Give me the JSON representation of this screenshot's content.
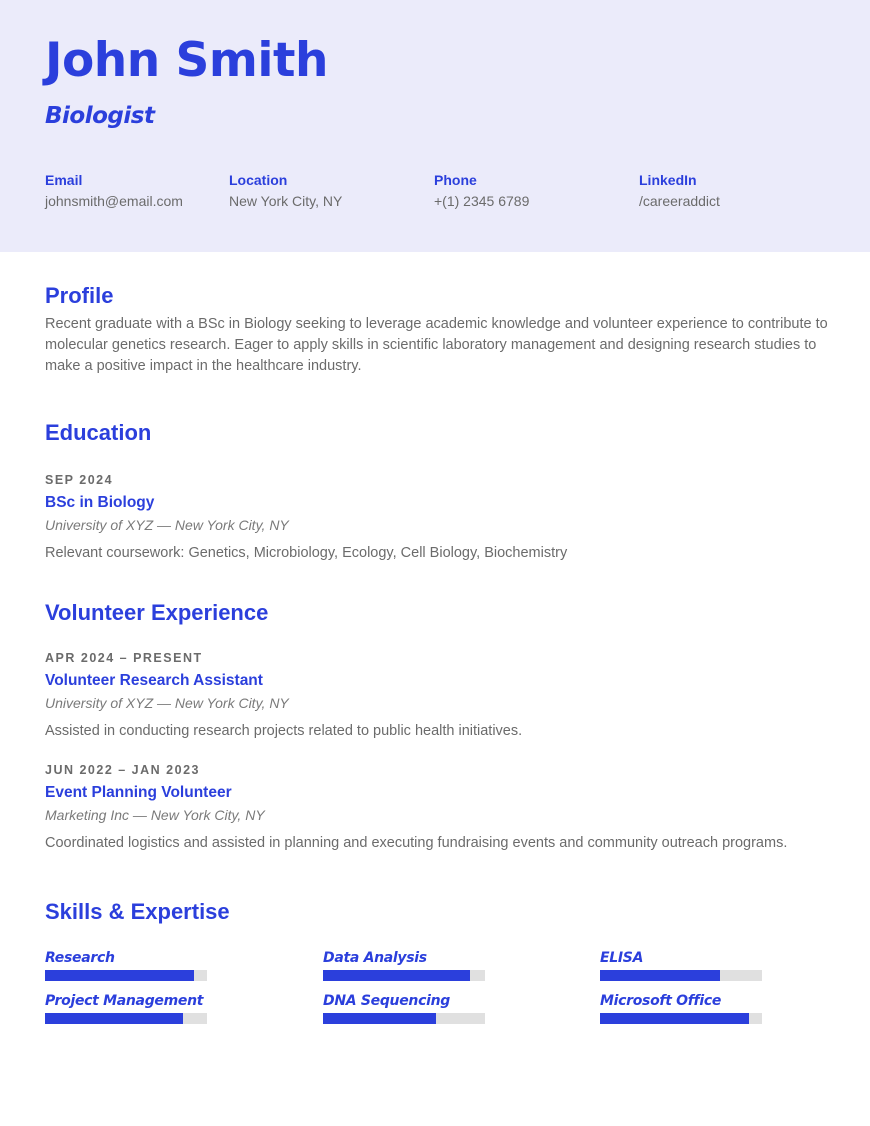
{
  "colors": {
    "accent": "#2b3fdc",
    "header_bg": "#ebebfa",
    "bar_track": "#e0e0e0",
    "text": "#6b6b6b"
  },
  "header": {
    "name": "John Smith",
    "title": "Biologist",
    "contacts": [
      {
        "label": "Email",
        "value": "johnsmith@email.com"
      },
      {
        "label": "Location",
        "value": "New York City, NY"
      },
      {
        "label": "Phone",
        "value": "+(1) 2345 6789"
      },
      {
        "label": "LinkedIn",
        "value": "/careeraddict"
      }
    ]
  },
  "profile": {
    "heading": "Profile",
    "text": "Recent graduate with a BSc in Biology seeking to leverage academic knowledge and volunteer experience to contribute to molecular genetics research. Eager to apply skills in scientific laboratory management and designing research studies to make a positive impact in the healthcare industry."
  },
  "education": {
    "heading": "Education",
    "entries": [
      {
        "date": "SEP 2024",
        "role": "BSc in Biology",
        "org": "University of XYZ — New York City, NY",
        "desc": "Relevant coursework: Genetics, Microbiology, Ecology, Cell Biology, Biochemistry"
      }
    ]
  },
  "volunteer": {
    "heading": "Volunteer Experience",
    "entries": [
      {
        "date": "APR 2024 – PRESENT",
        "role": "Volunteer Research Assistant",
        "org": "University of XYZ — New York City, NY",
        "desc": "Assisted in conducting research projects related to public health initiatives."
      },
      {
        "date": "JUN 2022 – JAN 2023",
        "role": "Event Planning Volunteer",
        "org": "Marketing Inc — New York City, NY",
        "desc": "Coordinated logistics and assisted in planning and executing fundraising events and community outreach programs."
      }
    ]
  },
  "skills": {
    "heading": "Skills & Expertise",
    "items": [
      {
        "name": "Research",
        "level_percent": 92
      },
      {
        "name": "Data Analysis",
        "level_percent": 91
      },
      {
        "name": "ELISA",
        "level_percent": 74
      },
      {
        "name": "Project Management",
        "level_percent": 85
      },
      {
        "name": "DNA Sequencing",
        "level_percent": 70
      },
      {
        "name": "Microsoft Office",
        "level_percent": 92
      }
    ]
  }
}
